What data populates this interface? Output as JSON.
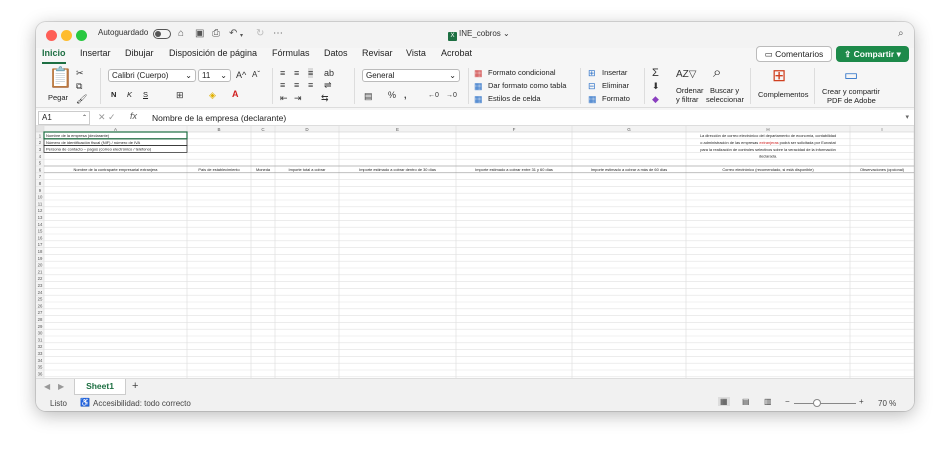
{
  "titlebar": {
    "autosave_label": "Autoguardado",
    "doc_title": "INE_cobros"
  },
  "tabs": [
    "Inicio",
    "Insertar",
    "Dibujar",
    "Disposición de página",
    "Fórmulas",
    "Datos",
    "Revisar",
    "Vista",
    "Acrobat"
  ],
  "header_buttons": {
    "comments": "Comentarios",
    "share": "Compartir"
  },
  "ribbon": {
    "paste": "Pegar",
    "font_name": "Calibri (Cuerpo)",
    "font_size": "11",
    "bold": "N",
    "italic": "K",
    "underline": "S",
    "number_format": "General",
    "conditional_format": "Formato condicional",
    "format_table": "Dar formato como tabla",
    "cell_styles": "Estilos de celda",
    "insert": "Insertar",
    "delete": "Eliminar",
    "format": "Formato",
    "sort_filter_1": "Ordenar",
    "sort_filter_2": "y filtrar",
    "find_select_1": "Buscar y",
    "find_select_2": "seleccionar",
    "addins": "Complementos",
    "adobe_1": "Crear y compartir",
    "adobe_2": "PDF de Adobe"
  },
  "formula_bar": {
    "cell_ref": "A1",
    "content": "Nombre de la empresa (declarante)"
  },
  "columns": [
    "A",
    "B",
    "C",
    "D",
    "E",
    "F",
    "G",
    "H",
    "I"
  ],
  "info_rows": [
    "Nombre de la empresa (declarante)",
    "Número de identificación fiscal (NIF) / número de IVA",
    "Persona de contacto – pagos (correo electrónico / teléfono)"
  ],
  "note_lines": [
    "La dirección de correo electrónico del departamento de economía, contabilidad",
    "o administración de las empresas",
    "extranjeras",
    "podrá ser solicitada por Eurostat",
    "para la realización de controles selectivos sobre la veracidad de la información",
    "declarada."
  ],
  "headers": [
    "Nombre de la contraparte empresarial extranjera",
    "País de establecimiento",
    "Moneda",
    "Importe total a cobrar",
    "Importe estimado a cobrar dentro de 30 días",
    "Importe estimado a cobrar entre 31 y 60 días",
    "Importe estimado a cobrar a más de 60 días",
    "Correo electrónico (recomendado, si está disponible)",
    "Observaciones (opcional)"
  ],
  "row_numbers": [
    "1",
    "2",
    "3",
    "4",
    "5",
    "6",
    "7",
    "8",
    "9",
    "10",
    "11",
    "12",
    "13",
    "14",
    "15",
    "16",
    "17",
    "18",
    "19",
    "20",
    "21",
    "22",
    "23",
    "24",
    "25",
    "26",
    "27",
    "28",
    "29",
    "30",
    "31",
    "32",
    "33",
    "34",
    "35",
    "36"
  ],
  "sheet_tab": "Sheet1",
  "status": {
    "ready": "Listo",
    "accessibility": "Accesibilidad: todo correcto",
    "zoom": "70 %"
  },
  "colors": {
    "brand_green": "#1d6f42",
    "share_green": "#1d8a4a",
    "red_text": "#d02020"
  }
}
